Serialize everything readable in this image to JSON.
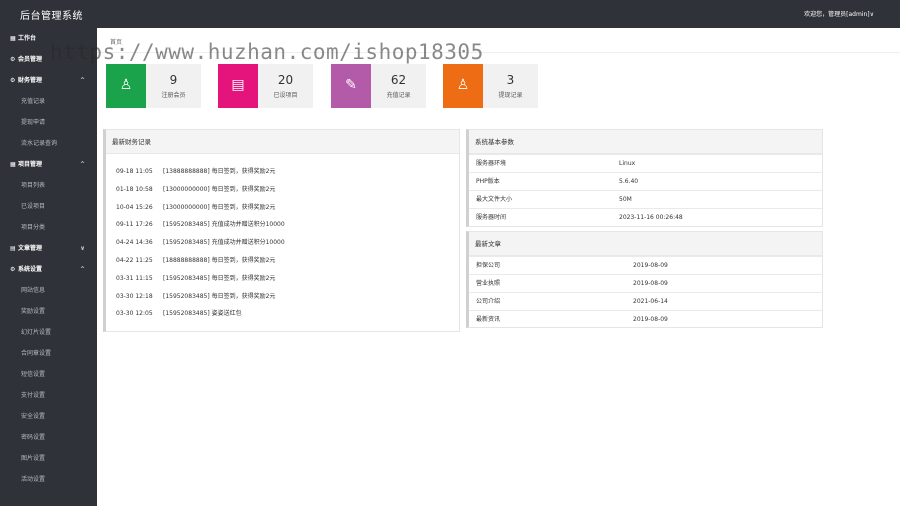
{
  "header": {
    "brand": "后台管理系统",
    "user": "欢迎您，管理员[admin]∨"
  },
  "sidebar": {
    "items": [
      {
        "label": "工作台",
        "type": "group",
        "icon": "dashboard-icon",
        "glyph": "▦",
        "arrow": ""
      },
      {
        "label": "会员管理",
        "type": "group",
        "icon": "gear-icon",
        "glyph": "⚙",
        "arrow": ""
      },
      {
        "label": "财务管理",
        "type": "group",
        "icon": "gear-icon",
        "glyph": "⚙",
        "arrow": "^"
      },
      {
        "label": "充值记录",
        "type": "sub"
      },
      {
        "label": "提现申请",
        "type": "sub"
      },
      {
        "label": "流水记录查询",
        "type": "sub"
      },
      {
        "label": "项目管理",
        "type": "group",
        "icon": "grid-icon",
        "glyph": "▦",
        "arrow": "^"
      },
      {
        "label": "项目列表",
        "type": "sub"
      },
      {
        "label": "已设项目",
        "type": "sub"
      },
      {
        "label": "项目分类",
        "type": "sub"
      },
      {
        "label": "文章管理",
        "type": "group",
        "icon": "document-icon",
        "glyph": "▤",
        "arrow": "∨"
      },
      {
        "label": "系统设置",
        "type": "group",
        "icon": "gear-icon",
        "glyph": "⚙",
        "arrow": "^"
      },
      {
        "label": "网站信息",
        "type": "sub"
      },
      {
        "label": "奖励设置",
        "type": "sub"
      },
      {
        "label": "幻灯片设置",
        "type": "sub"
      },
      {
        "label": "合同章设置",
        "type": "sub"
      },
      {
        "label": "短信设置",
        "type": "sub"
      },
      {
        "label": "支付设置",
        "type": "sub"
      },
      {
        "label": "安全设置",
        "type": "sub"
      },
      {
        "label": "密码设置",
        "type": "sub"
      },
      {
        "label": "图片设置",
        "type": "sub"
      },
      {
        "label": "活动设置",
        "type": "sub"
      }
    ]
  },
  "breadcrumb": "首页",
  "stats": [
    {
      "value": "9",
      "label": "注册会员",
      "color": "#1aa34a",
      "icon": "user-icon",
      "glyph": "♙"
    },
    {
      "value": "20",
      "label": "已设项目",
      "color": "#e4147c",
      "icon": "clipboard-icon",
      "glyph": "▤"
    },
    {
      "value": "62",
      "label": "充值记录",
      "color": "#b35aa8",
      "icon": "recharge-icon",
      "glyph": "✎"
    },
    {
      "value": "3",
      "label": "提现记录",
      "color": "#ee6d14",
      "icon": "money-bag-icon",
      "glyph": "♙"
    }
  ],
  "finance": {
    "title": "最新财务记录",
    "rows": [
      {
        "time": "09-18 11:05",
        "text": "[13888888888] 每日签到，获得奖励2元"
      },
      {
        "time": "01-18 10:58",
        "text": "[13000000000] 每日签到，获得奖励2元"
      },
      {
        "time": "10-04 15:26",
        "text": "[13000000000] 每日签到，获得奖励2元"
      },
      {
        "time": "09-11 17:26",
        "text": "[15952083485] 充值成功并赠送积分10000"
      },
      {
        "time": "04-24 14:36",
        "text": "[15952083485] 充值成功并赠送积分10000"
      },
      {
        "time": "04-22 11:25",
        "text": "[18888888888] 每日签到，获得奖励2元"
      },
      {
        "time": "03-31 11:15",
        "text": "[15952083485] 每日签到，获得奖励2元"
      },
      {
        "time": "03-30 12:18",
        "text": "[15952083485] 每日签到，获得奖励2元"
      },
      {
        "time": "03-30 12:05",
        "text": "[15952083485] 姿姿送红包"
      }
    ]
  },
  "system": {
    "title": "系统基本参数",
    "rows": [
      {
        "key": "服务器环境",
        "value": "Linux"
      },
      {
        "key": "PHP版本",
        "value": "5.6.40"
      },
      {
        "key": "最大文件大小",
        "value": "50M"
      },
      {
        "key": "服务器时间",
        "value": "2023-11-16 00:26:48"
      }
    ]
  },
  "articles": {
    "title": "最新文章",
    "rows": [
      {
        "key": "担保公司",
        "value": "2019-08-09"
      },
      {
        "key": "营业执照",
        "value": "2019-08-09"
      },
      {
        "key": "公司介绍",
        "value": "2021-06-14"
      },
      {
        "key": "最新资讯",
        "value": "2019-08-09"
      }
    ]
  },
  "watermark": "https://www.huzhan.com/ishop18305"
}
